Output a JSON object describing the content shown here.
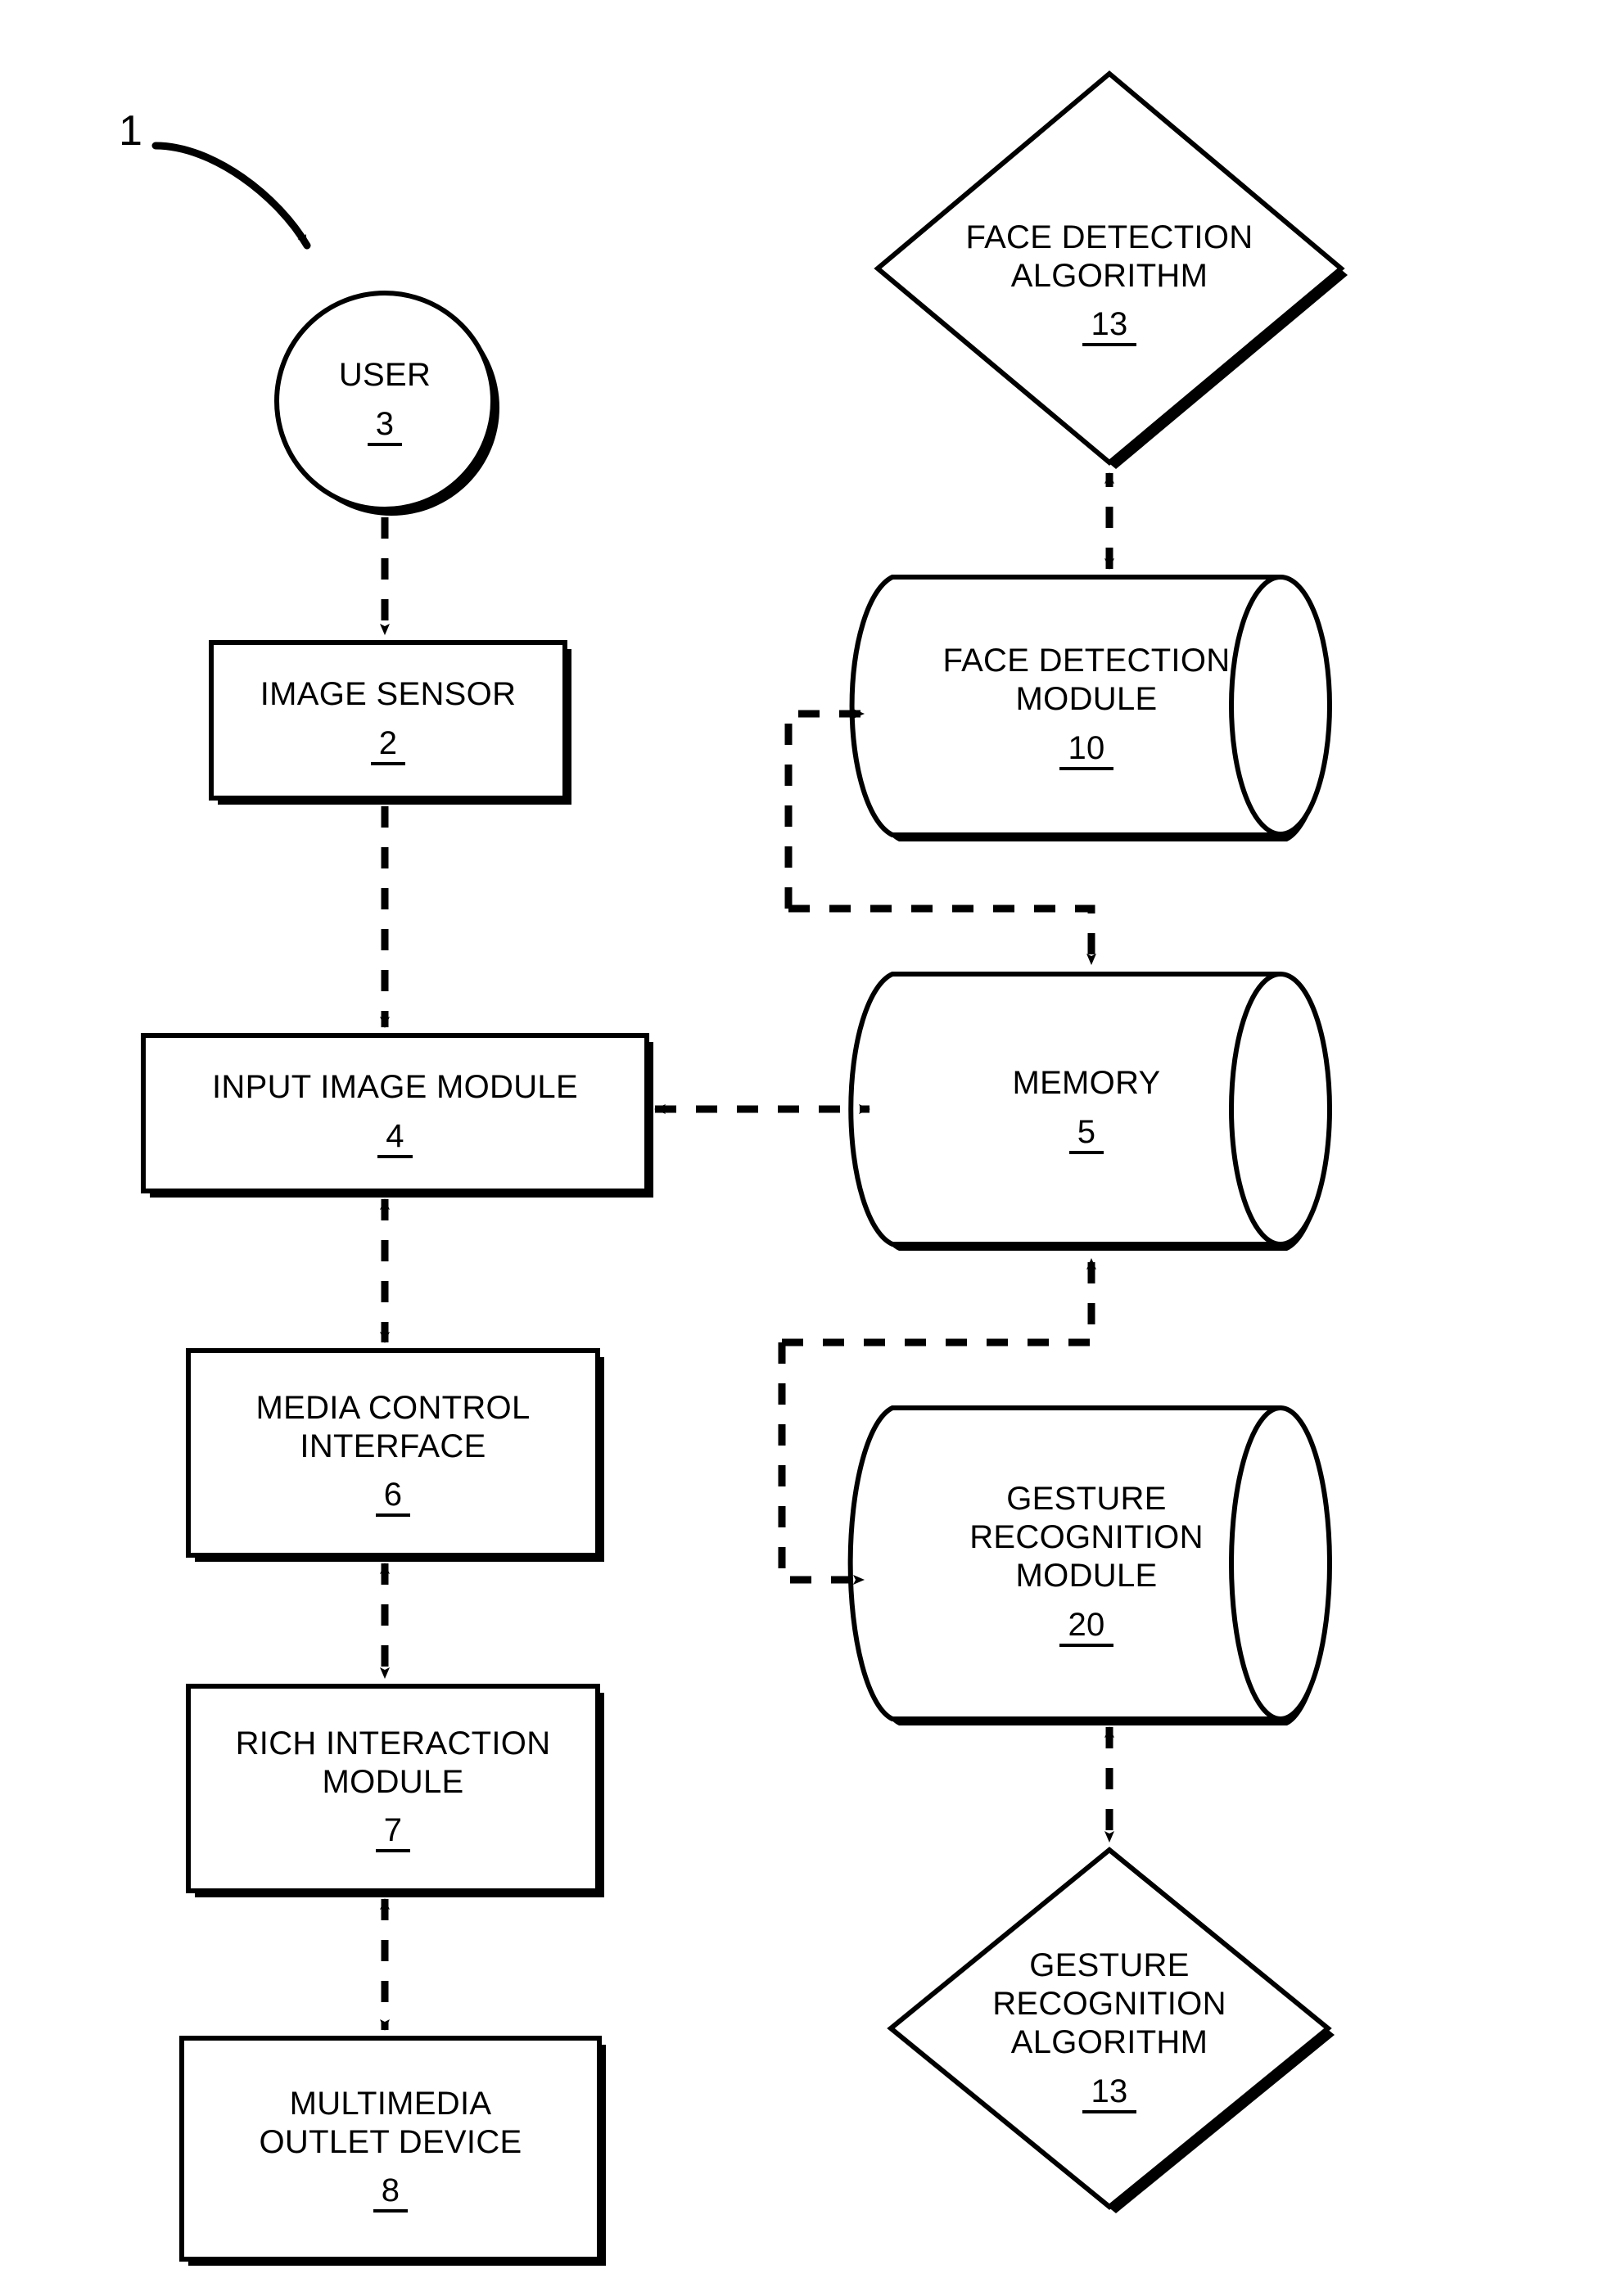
{
  "figure": {
    "reference_numeral": "1",
    "nodes": [
      {
        "id": "user",
        "shape": "circle",
        "label": "USER",
        "ref": "3"
      },
      {
        "id": "image-sensor",
        "shape": "rect",
        "label": "IMAGE SENSOR",
        "ref": "2"
      },
      {
        "id": "input-image-module",
        "shape": "rect",
        "label": "INPUT IMAGE MODULE",
        "ref": "4"
      },
      {
        "id": "media-control-interface",
        "shape": "rect",
        "label": "MEDIA CONTROL\nINTERFACE",
        "ref": "6"
      },
      {
        "id": "rich-interaction-module",
        "shape": "rect",
        "label": "RICH INTERACTION\nMODULE",
        "ref": "7"
      },
      {
        "id": "multimedia-outlet-device",
        "shape": "rect",
        "label": "MULTIMEDIA\nOUTLET DEVICE",
        "ref": "8"
      },
      {
        "id": "face-detection-algorithm",
        "shape": "diamond",
        "label": "FACE DETECTION\nALGORITHM",
        "ref": "13"
      },
      {
        "id": "face-detection-module",
        "shape": "cylinder",
        "label": "FACE DETECTION\nMODULE",
        "ref": "10"
      },
      {
        "id": "memory",
        "shape": "cylinder",
        "label": "MEMORY",
        "ref": "5"
      },
      {
        "id": "gesture-recognition-module",
        "shape": "cylinder",
        "label": "GESTURE\nRECOGNITION\nMODULE",
        "ref": "20"
      },
      {
        "id": "gesture-recognition-algorithm",
        "shape": "diamond",
        "label": "GESTURE\nRECOGNITION\nALGORITHM",
        "ref": "13"
      }
    ],
    "connectors": [
      {
        "from": "user",
        "to": "image-sensor",
        "style": "dashed",
        "direction": "one-way"
      },
      {
        "from": "image-sensor",
        "to": "input-image-module",
        "style": "dashed",
        "direction": "one-way"
      },
      {
        "from": "input-image-module",
        "to": "memory",
        "style": "dashed",
        "direction": "two-way"
      },
      {
        "from": "input-image-module",
        "to": "media-control-interface",
        "style": "dashed",
        "direction": "two-way"
      },
      {
        "from": "media-control-interface",
        "to": "rich-interaction-module",
        "style": "dashed",
        "direction": "two-way"
      },
      {
        "from": "rich-interaction-module",
        "to": "multimedia-outlet-device",
        "style": "dashed",
        "direction": "two-way"
      },
      {
        "from": "face-detection-module",
        "to": "face-detection-algorithm",
        "style": "dashed",
        "direction": "two-way"
      },
      {
        "from": "memory",
        "to": "face-detection-module",
        "style": "dashed",
        "direction": "one-way"
      },
      {
        "from": "face-detection-module",
        "to": "memory",
        "style": "dashed",
        "direction": "one-way"
      },
      {
        "from": "memory",
        "to": "gesture-recognition-module",
        "style": "dashed",
        "direction": "one-way"
      },
      {
        "from": "gesture-recognition-module",
        "to": "memory",
        "style": "dashed",
        "direction": "one-way"
      },
      {
        "from": "gesture-recognition-module",
        "to": "gesture-recognition-algorithm",
        "style": "dashed",
        "direction": "two-way"
      }
    ],
    "colors": {
      "stroke": "#000000",
      "fill": "#ffffff",
      "background": "#ffffff"
    }
  }
}
